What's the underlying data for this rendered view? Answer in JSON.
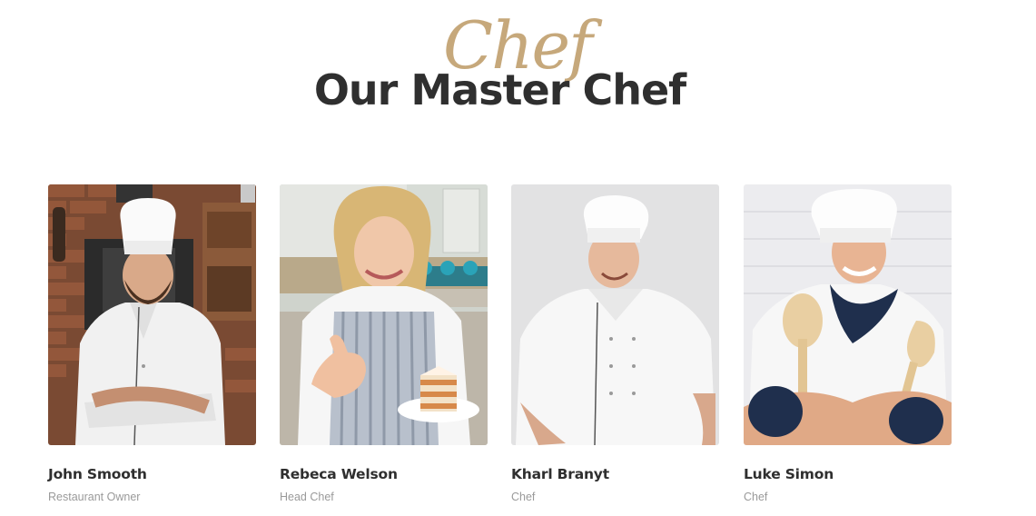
{
  "heading": {
    "script_word": "Chef",
    "title": "Our Master Chef",
    "accent_color": "#c6a87b"
  },
  "team": [
    {
      "name": "John Smooth",
      "role": "Restaurant Owner",
      "photo": "chef-portrait-kitchen-brick"
    },
    {
      "name": "Rebeca Welson",
      "role": "Head Chef",
      "photo": "chef-holding-cake"
    },
    {
      "name": "Kharl Branyt",
      "role": "Chef",
      "photo": "chef-portrait-grey"
    },
    {
      "name": "Luke Simon",
      "role": "Chef",
      "photo": "chef-with-wooden-spoons"
    }
  ]
}
